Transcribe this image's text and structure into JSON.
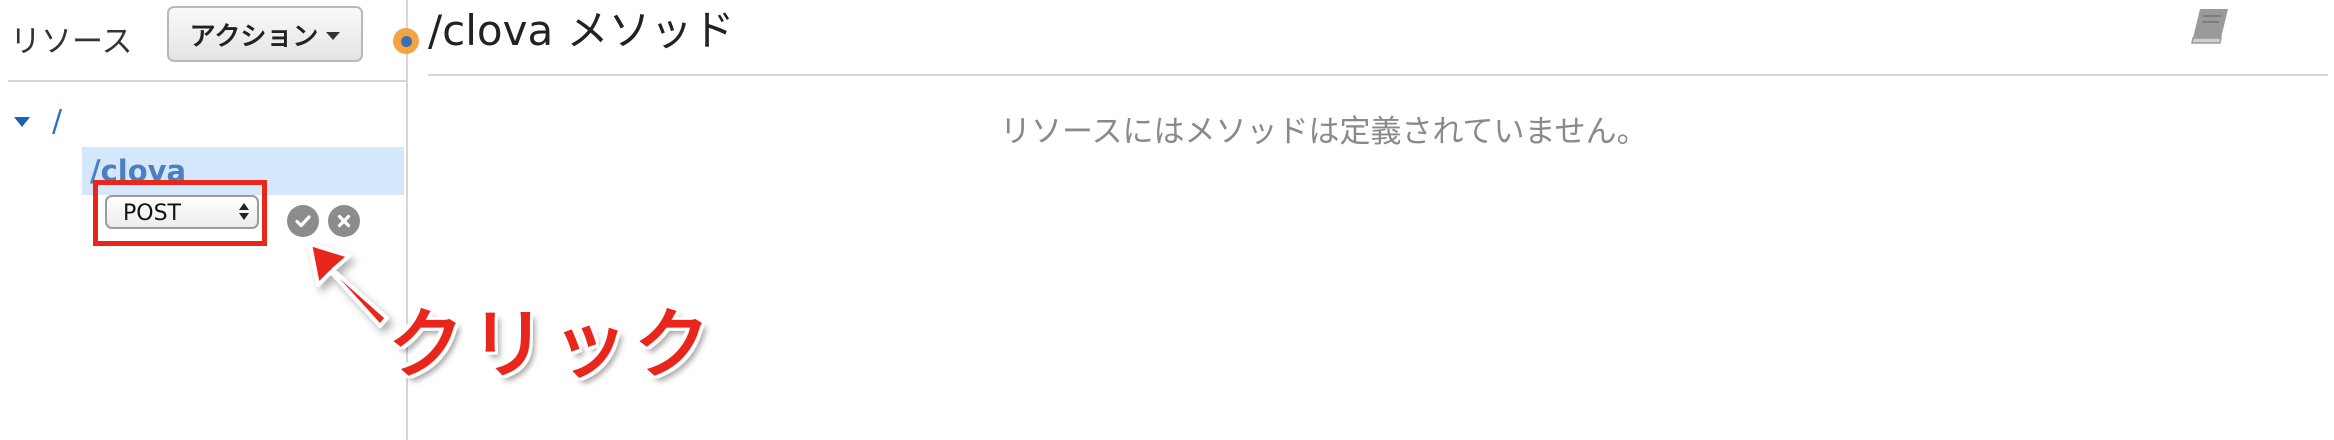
{
  "sidebar": {
    "resources_label": "リソース",
    "actions_label": "アクション",
    "tree": {
      "root_label": "/",
      "selected_label": "/clova"
    },
    "method_select": {
      "value": "POST"
    }
  },
  "main": {
    "title": "/clova メソッド",
    "empty_message": "リソースにはメソッドは定義されていません。"
  },
  "annotation": {
    "text": "クリック",
    "color": "#e8261b"
  },
  "icons": {
    "confirm": "check-circle-icon",
    "cancel": "x-circle-icon",
    "docs": "book-icon",
    "status": "status-dot-icon",
    "tree_toggle": "caret-down-icon"
  },
  "colors": {
    "link_blue": "#2e6fc7",
    "selected_bg": "#d5e7fb",
    "highlight_red": "#e8261b",
    "muted_text": "#8a8a8a",
    "status_orange": "#f2a541"
  }
}
